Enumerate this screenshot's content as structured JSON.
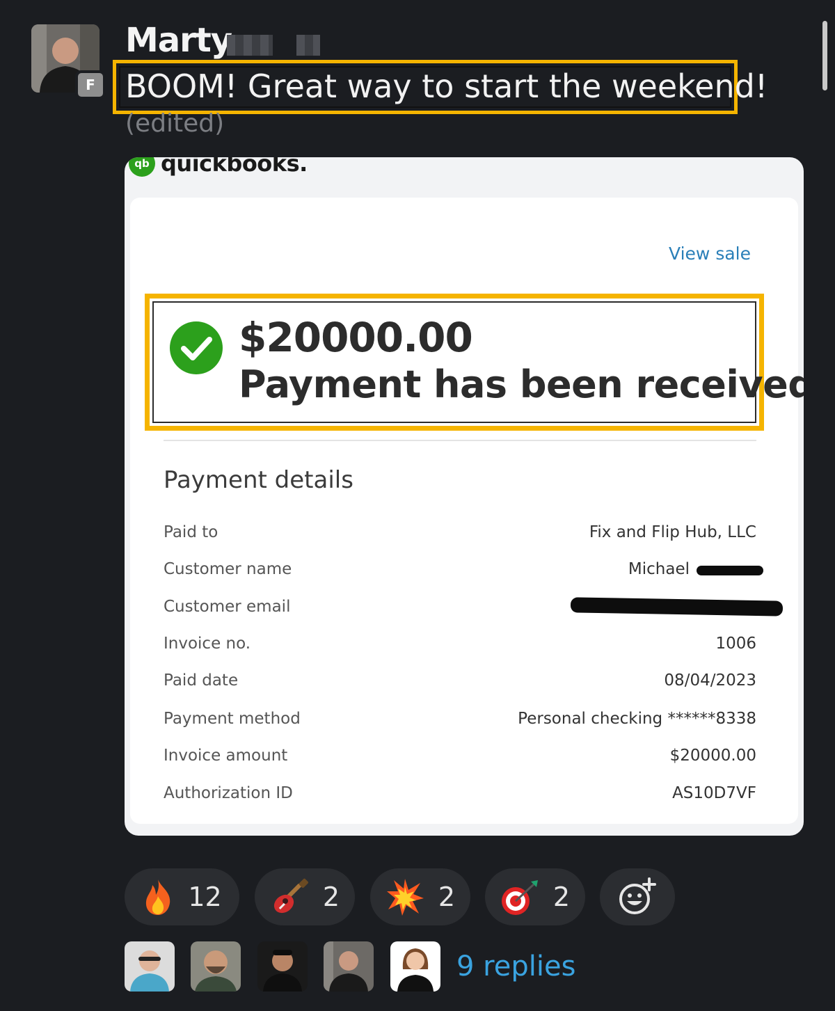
{
  "message": {
    "author": "Marty",
    "author_badge": "F",
    "text": "BOOM! Great way to start the weekend!",
    "edited_label": "(edited)"
  },
  "attachment": {
    "brand": "quickbooks.",
    "brand_mark": "qb",
    "view_sale_label": "View sale",
    "amount": "$20000.00",
    "status": "Payment has been received",
    "section_title": "Payment details",
    "details": [
      {
        "label": "Paid to",
        "value": "Fix and Flip Hub, LLC"
      },
      {
        "label": "Customer name",
        "value": "Michael"
      },
      {
        "label": "Customer email",
        "value": ""
      },
      {
        "label": "Invoice no.",
        "value": "1006"
      },
      {
        "label": "Paid date",
        "value": "08/04/2023"
      },
      {
        "label": "Payment method",
        "value": "Personal checking ******8338"
      },
      {
        "label": "Invoice amount",
        "value": "$20000.00"
      },
      {
        "label": "Authorization ID",
        "value": "AS10D7VF"
      }
    ],
    "colors": {
      "highlight": "#f5b400",
      "success": "#2ca01c",
      "link": "#2a7fb8"
    }
  },
  "reactions": [
    {
      "icon": "fire-emoji-icon",
      "count": "12"
    },
    {
      "icon": "guitar-emoji-icon",
      "count": "2"
    },
    {
      "icon": "collision-emoji-icon",
      "count": "2"
    },
    {
      "icon": "direct-hit-emoji-icon",
      "count": "2"
    }
  ],
  "add_reaction_icon": "add-reaction-icon",
  "thread": {
    "replies_label": "9 replies",
    "participant_count": 5
  }
}
